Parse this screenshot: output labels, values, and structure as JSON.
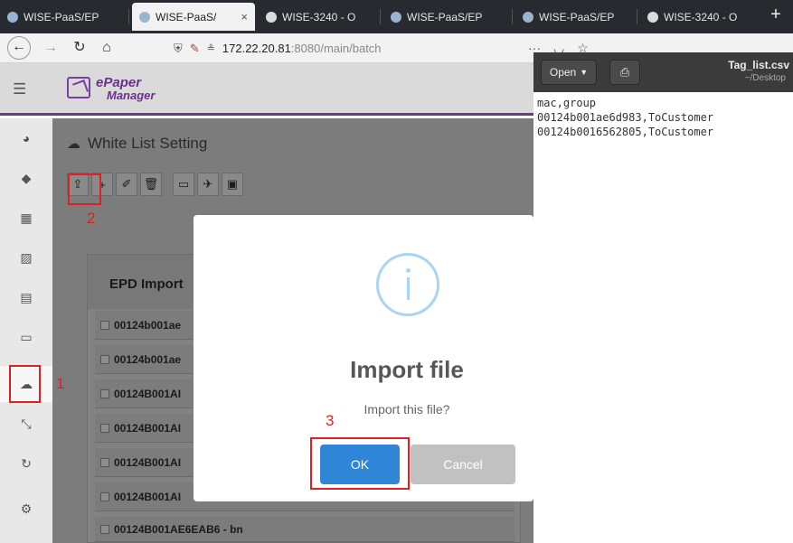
{
  "browser": {
    "tabs": [
      {
        "label": "WISE-PaaS/EP",
        "active": false
      },
      {
        "label": "WISE-PaaS/",
        "active": true,
        "close": "×"
      },
      {
        "label": "WISE-3240 - O",
        "active": false
      },
      {
        "label": "WISE-PaaS/EP",
        "active": false
      },
      {
        "label": "WISE-PaaS/EP",
        "active": false
      },
      {
        "label": "WISE-3240 - O",
        "active": false
      }
    ],
    "new_tab": "+",
    "url_host": "172.22.20.81",
    "url_rest": ":8080/main/batch"
  },
  "app": {
    "logo_line1": "ePaper",
    "logo_line2": "Manager",
    "page_title": "White List Setting",
    "panel_header": "EPD Import",
    "list_rows": [
      "00124b001ae",
      "00124b001ae",
      "00124B001AI",
      "00124B001AI",
      "00124B001AI",
      "00124B001AI",
      "00124B001AE6EAB6 - bn"
    ]
  },
  "dialog": {
    "title": "Import file",
    "message": "Import this file?",
    "ok": "OK",
    "cancel": "Cancel"
  },
  "editor": {
    "open_label": "Open",
    "filename": "Tag_list.csv",
    "path": "~/Desktop",
    "lines": [
      "mac,group",
      "00124b001ae6d983,ToCustomer",
      "00124b0016562805,ToCustomer"
    ]
  },
  "annotations": {
    "step1": "1",
    "step2": "2",
    "step3": "3"
  },
  "colors": {
    "accent_purple": "#6b3a8a",
    "ok_blue": "#3086d6",
    "highlight_red": "#e02020"
  }
}
